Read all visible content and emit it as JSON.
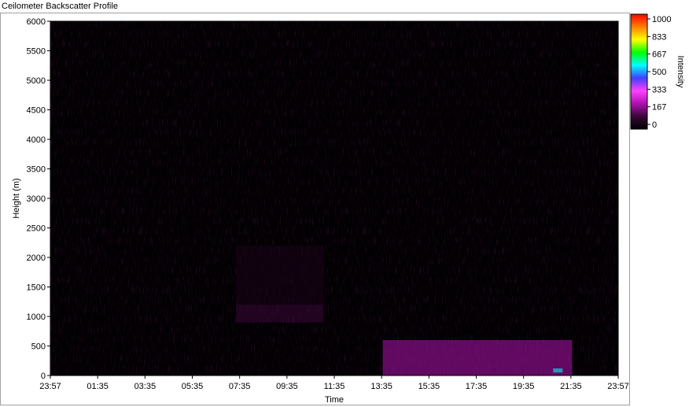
{
  "window": {
    "title": "Ceilometer Backscatter Profile"
  },
  "chart_data": {
    "type": "heatmap",
    "title": "Ceilometer Backscatter Profile",
    "xlabel": "Time",
    "ylabel": "Height (m)",
    "x_ticks": [
      "23:57",
      "01:35",
      "03:35",
      "05:35",
      "07:35",
      "09:35",
      "11:35",
      "13:35",
      "15:35",
      "17:35",
      "19:35",
      "21:35",
      "23:57"
    ],
    "x_range_hours": [
      -0.05,
      23.95
    ],
    "y_ticks": [
      0,
      500,
      1000,
      1500,
      2000,
      2500,
      3000,
      3500,
      4000,
      4500,
      5000,
      5500,
      6000
    ],
    "ylim": [
      0,
      6000
    ],
    "colorbar": {
      "label": "Intensity",
      "range": [
        0,
        1000
      ],
      "ticks": [
        "0",
        "167",
        "333",
        "500",
        "667",
        "833",
        "1000"
      ],
      "colors": [
        "#000000",
        "#3a0838",
        "#b010b0",
        "#ff40ff",
        "#4040ff",
        "#00ffff",
        "#00ff00",
        "#ffff00",
        "#ff8000",
        "#ff0000"
      ]
    },
    "features": [
      {
        "name": "near-surface layer",
        "t_start": 0.0,
        "t_end": 24.0,
        "h_low": 0,
        "h_high": 1200,
        "intensity": 60
      },
      {
        "name": "boundary layer top",
        "t_start": 14.0,
        "t_end": 22.0,
        "h_low": 0,
        "h_high": 600,
        "intensity": 200
      },
      {
        "name": "peak near surface",
        "t_start": 21.2,
        "t_end": 21.6,
        "h_low": 50,
        "h_high": 120,
        "intensity": 550
      },
      {
        "name": "elevated layer",
        "t_start": 7.8,
        "t_end": 11.5,
        "h_low": 900,
        "h_high": 2200,
        "intensity": 180
      },
      {
        "name": "noise upper",
        "t_start": 0.0,
        "t_end": 24.0,
        "h_low": 1200,
        "h_high": 6000,
        "intensity": 40
      }
    ]
  }
}
